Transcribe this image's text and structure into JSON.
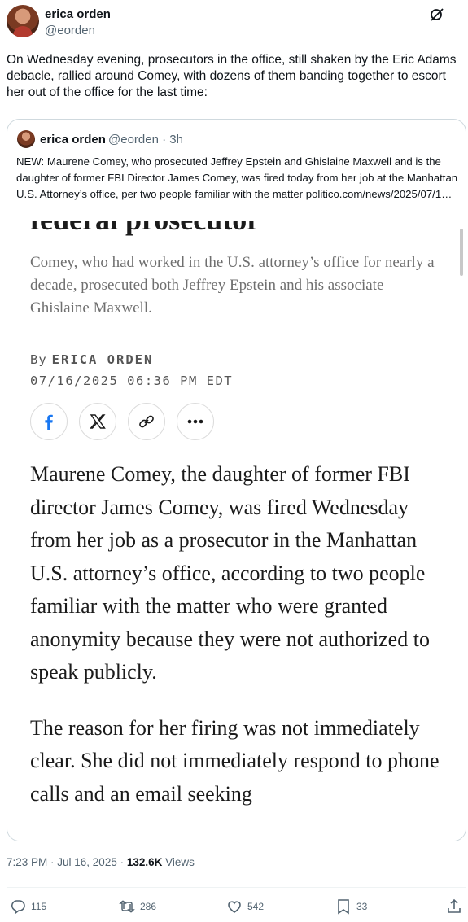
{
  "tweet": {
    "author_name": "erica orden",
    "author_handle": "@eorden",
    "text": "On Wednesday evening, prosecutors in the office, still shaken by the Eric Adams debacle, rallied around Comey, with dozens of them banding together to escort her out of the office for the last time:",
    "timestamp": "7:23 PM · Jul 16, 2025 · ",
    "views_count": "132.6K",
    "views_label": " Views"
  },
  "quote": {
    "author_name": "erica orden",
    "author_handle": "@eorden · 3h",
    "text": "NEW: Maurene Comey, who prosecuted Jeffrey Epstein and Ghislaine Maxwell and is the daughter of former FBI Director James Comey, was fired today from her job at the Manhattan U.S. Attorney’s office, per two people familiar with the matter politico.com/news/2025/07/1…"
  },
  "article": {
    "heading_fragment": "federal prosecutor",
    "subheading": "Comey, who had worked in the U.S. attorney’s office for nearly a decade, prosecuted both Jeffrey Epstein and his associate Ghislaine Maxwell.",
    "byline_prefix": "By",
    "byline_name": "ERICA ORDEN",
    "dateline": "07/16/2025 06:36 PM EDT",
    "share_icons": [
      "facebook-icon",
      "x-icon",
      "link-icon",
      "more-icon"
    ],
    "paragraph_1": "Maurene Comey, the daughter of former FBI director James Comey, was fired Wednesday from her job as a prosecutor in the Manhattan U.S. attorney’s office, according to two people familiar with the matter who were granted anonymity because they were not authorized to speak publicly.",
    "paragraph_2": "The reason for her firing was not immediately clear. She did not immediately respond to phone calls and an email seeking"
  },
  "actions": {
    "replies": "115",
    "reposts": "286",
    "likes": "542",
    "bookmarks": "33"
  },
  "icons": [
    "grok-icon",
    "reply-icon",
    "repost-icon",
    "like-icon",
    "bookmark-icon",
    "share-icon"
  ],
  "colors": {
    "text": "#0f1419",
    "muted": "#536471",
    "border": "#cfd9de",
    "facebook": "#1877f2"
  }
}
